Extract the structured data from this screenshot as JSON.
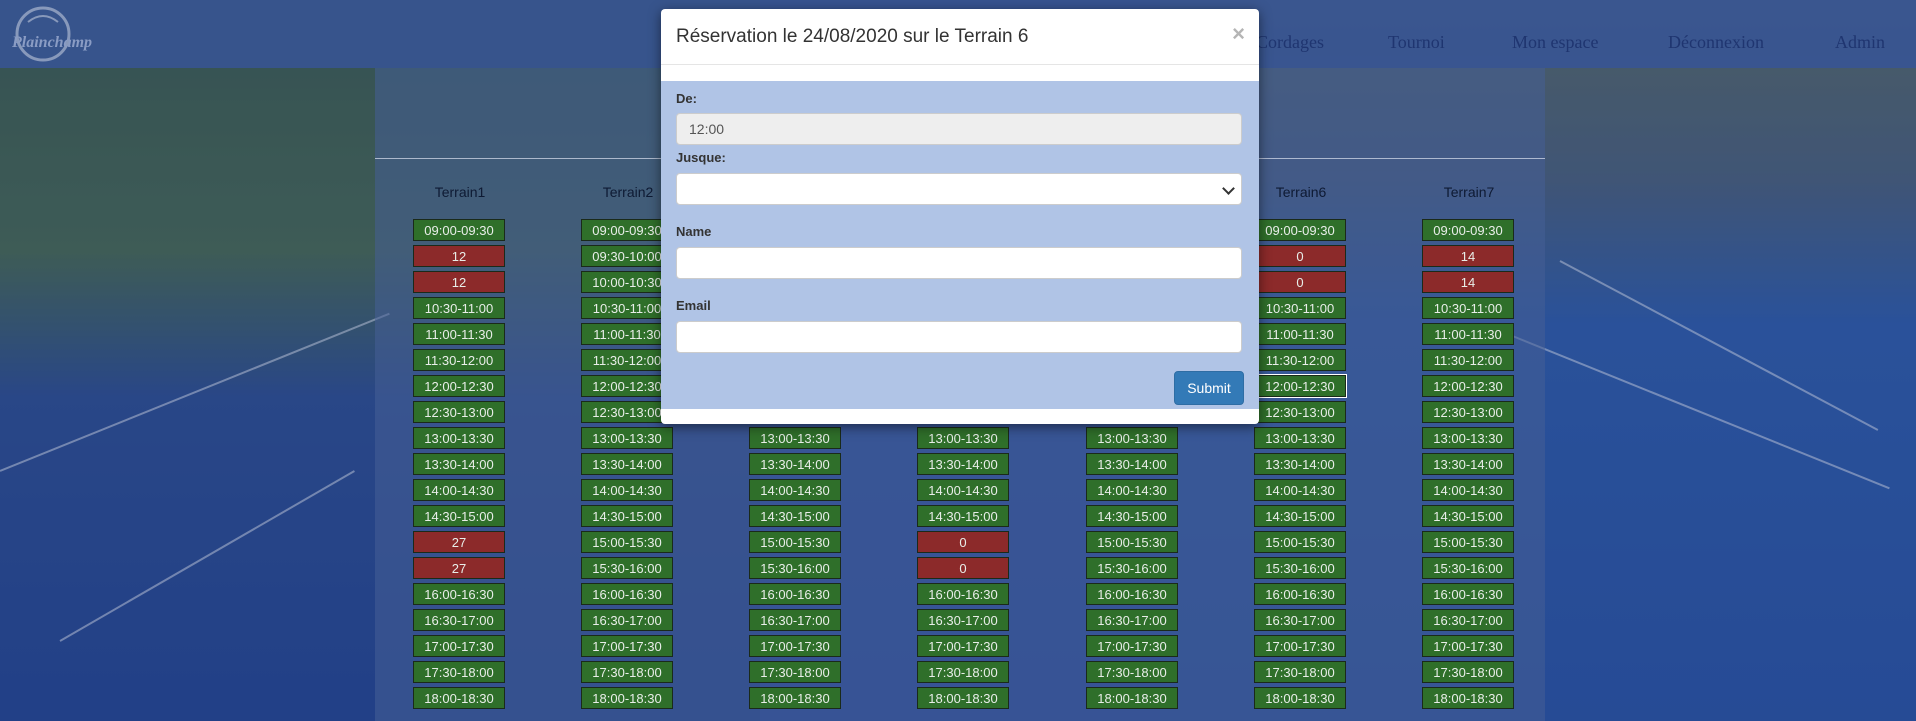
{
  "nav": {
    "brand": "Plainchamp",
    "links": [
      "Cordages",
      "Tournoi",
      "Mon espace",
      "Déconnexion",
      "Admin"
    ]
  },
  "courts": [
    {
      "name": "Terrain1",
      "slots": [
        {
          "t": "09:00-09:30",
          "s": "free"
        },
        {
          "t": "12",
          "s": "busy"
        },
        {
          "t": "12",
          "s": "busy"
        },
        {
          "t": "10:30-11:00",
          "s": "free"
        },
        {
          "t": "11:00-11:30",
          "s": "free"
        },
        {
          "t": "11:30-12:00",
          "s": "free"
        },
        {
          "t": "12:00-12:30",
          "s": "free"
        },
        {
          "t": "12:30-13:00",
          "s": "free"
        },
        {
          "t": "13:00-13:30",
          "s": "free"
        },
        {
          "t": "13:30-14:00",
          "s": "free"
        },
        {
          "t": "14:00-14:30",
          "s": "free"
        },
        {
          "t": "14:30-15:00",
          "s": "free"
        },
        {
          "t": "27",
          "s": "busy"
        },
        {
          "t": "27",
          "s": "busy"
        },
        {
          "t": "16:00-16:30",
          "s": "free"
        },
        {
          "t": "16:30-17:00",
          "s": "free"
        },
        {
          "t": "17:00-17:30",
          "s": "free"
        },
        {
          "t": "17:30-18:00",
          "s": "free"
        },
        {
          "t": "18:00-18:30",
          "s": "free"
        }
      ]
    },
    {
      "name": "Terrain2",
      "slots": [
        {
          "t": "09:00-09:30",
          "s": "free"
        },
        {
          "t": "09:30-10:00",
          "s": "free"
        },
        {
          "t": "10:00-10:30",
          "s": "free"
        },
        {
          "t": "10:30-11:00",
          "s": "free"
        },
        {
          "t": "11:00-11:30",
          "s": "free"
        },
        {
          "t": "11:30-12:00",
          "s": "free"
        },
        {
          "t": "12:00-12:30",
          "s": "free"
        },
        {
          "t": "12:30-13:00",
          "s": "free"
        },
        {
          "t": "13:00-13:30",
          "s": "free"
        },
        {
          "t": "13:30-14:00",
          "s": "free"
        },
        {
          "t": "14:00-14:30",
          "s": "free"
        },
        {
          "t": "14:30-15:00",
          "s": "free"
        },
        {
          "t": "15:00-15:30",
          "s": "free"
        },
        {
          "t": "15:30-16:00",
          "s": "free"
        },
        {
          "t": "16:00-16:30",
          "s": "free"
        },
        {
          "t": "16:30-17:00",
          "s": "free"
        },
        {
          "t": "17:00-17:30",
          "s": "free"
        },
        {
          "t": "17:30-18:00",
          "s": "free"
        },
        {
          "t": "18:00-18:30",
          "s": "free"
        }
      ]
    },
    {
      "name": "",
      "slots": [
        null,
        null,
        null,
        null,
        null,
        null,
        null,
        null,
        {
          "t": "13:00-13:30",
          "s": "free"
        },
        {
          "t": "13:30-14:00",
          "s": "free"
        },
        {
          "t": "14:00-14:30",
          "s": "free"
        },
        {
          "t": "14:30-15:00",
          "s": "free"
        },
        {
          "t": "15:00-15:30",
          "s": "free"
        },
        {
          "t": "15:30-16:00",
          "s": "free"
        },
        {
          "t": "16:00-16:30",
          "s": "free"
        },
        {
          "t": "16:30-17:00",
          "s": "free"
        },
        {
          "t": "17:00-17:30",
          "s": "free"
        },
        {
          "t": "17:30-18:00",
          "s": "free"
        },
        {
          "t": "18:00-18:30",
          "s": "free"
        }
      ]
    },
    {
      "name": "",
      "slots": [
        null,
        null,
        null,
        null,
        null,
        null,
        null,
        null,
        {
          "t": "13:00-13:30",
          "s": "free"
        },
        {
          "t": "13:30-14:00",
          "s": "free"
        },
        {
          "t": "14:00-14:30",
          "s": "free"
        },
        {
          "t": "14:30-15:00",
          "s": "free"
        },
        {
          "t": "0",
          "s": "busy"
        },
        {
          "t": "0",
          "s": "busy"
        },
        {
          "t": "16:00-16:30",
          "s": "free"
        },
        {
          "t": "16:30-17:00",
          "s": "free"
        },
        {
          "t": "17:00-17:30",
          "s": "free"
        },
        {
          "t": "17:30-18:00",
          "s": "free"
        },
        {
          "t": "18:00-18:30",
          "s": "free"
        }
      ]
    },
    {
      "name": "",
      "slots": [
        null,
        null,
        null,
        null,
        null,
        null,
        null,
        null,
        {
          "t": "13:00-13:30",
          "s": "free"
        },
        {
          "t": "13:30-14:00",
          "s": "free"
        },
        {
          "t": "14:00-14:30",
          "s": "free"
        },
        {
          "t": "14:30-15:00",
          "s": "free"
        },
        {
          "t": "15:00-15:30",
          "s": "free"
        },
        {
          "t": "15:30-16:00",
          "s": "free"
        },
        {
          "t": "16:00-16:30",
          "s": "free"
        },
        {
          "t": "16:30-17:00",
          "s": "free"
        },
        {
          "t": "17:00-17:30",
          "s": "free"
        },
        {
          "t": "17:30-18:00",
          "s": "free"
        },
        {
          "t": "18:00-18:30",
          "s": "free"
        }
      ]
    },
    {
      "name": "Terrain6",
      "slots": [
        {
          "t": "09:00-09:30",
          "s": "free"
        },
        {
          "t": "0",
          "s": "busy"
        },
        {
          "t": "0",
          "s": "busy"
        },
        {
          "t": "10:30-11:00",
          "s": "free"
        },
        {
          "t": "11:00-11:30",
          "s": "free"
        },
        {
          "t": "11:30-12:00",
          "s": "free"
        },
        {
          "t": "12:00-12:30",
          "s": "sel"
        },
        {
          "t": "12:30-13:00",
          "s": "free"
        },
        {
          "t": "13:00-13:30",
          "s": "free"
        },
        {
          "t": "13:30-14:00",
          "s": "free"
        },
        {
          "t": "14:00-14:30",
          "s": "free"
        },
        {
          "t": "14:30-15:00",
          "s": "free"
        },
        {
          "t": "15:00-15:30",
          "s": "free"
        },
        {
          "t": "15:30-16:00",
          "s": "free"
        },
        {
          "t": "16:00-16:30",
          "s": "free"
        },
        {
          "t": "16:30-17:00",
          "s": "free"
        },
        {
          "t": "17:00-17:30",
          "s": "free"
        },
        {
          "t": "17:30-18:00",
          "s": "free"
        },
        {
          "t": "18:00-18:30",
          "s": "free"
        }
      ]
    },
    {
      "name": "Terrain7",
      "slots": [
        {
          "t": "09:00-09:30",
          "s": "free"
        },
        {
          "t": "14",
          "s": "busy"
        },
        {
          "t": "14",
          "s": "busy"
        },
        {
          "t": "10:30-11:00",
          "s": "free"
        },
        {
          "t": "11:00-11:30",
          "s": "free"
        },
        {
          "t": "11:30-12:00",
          "s": "free"
        },
        {
          "t": "12:00-12:30",
          "s": "free"
        },
        {
          "t": "12:30-13:00",
          "s": "free"
        },
        {
          "t": "13:00-13:30",
          "s": "free"
        },
        {
          "t": "13:30-14:00",
          "s": "free"
        },
        {
          "t": "14:00-14:30",
          "s": "free"
        },
        {
          "t": "14:30-15:00",
          "s": "free"
        },
        {
          "t": "15:00-15:30",
          "s": "free"
        },
        {
          "t": "15:30-16:00",
          "s": "free"
        },
        {
          "t": "16:00-16:30",
          "s": "free"
        },
        {
          "t": "16:30-17:00",
          "s": "free"
        },
        {
          "t": "17:00-17:30",
          "s": "free"
        },
        {
          "t": "17:30-18:00",
          "s": "free"
        },
        {
          "t": "18:00-18:30",
          "s": "free"
        }
      ]
    }
  ],
  "modal": {
    "title": "Réservation le 24/08/2020 sur le Terrain 6",
    "close": "×",
    "from_label": "De:",
    "from_value": "12:00",
    "until_label": "Jusque:",
    "until_value": "",
    "name_label": "Name",
    "name_value": "",
    "email_label": "Email",
    "email_value": "",
    "submit_label": "Submit"
  },
  "colors": {
    "free": "#2f6f2a",
    "busy": "#8c2a2a",
    "primary": "#337ab7",
    "modal_body": "#b0c4e6"
  }
}
